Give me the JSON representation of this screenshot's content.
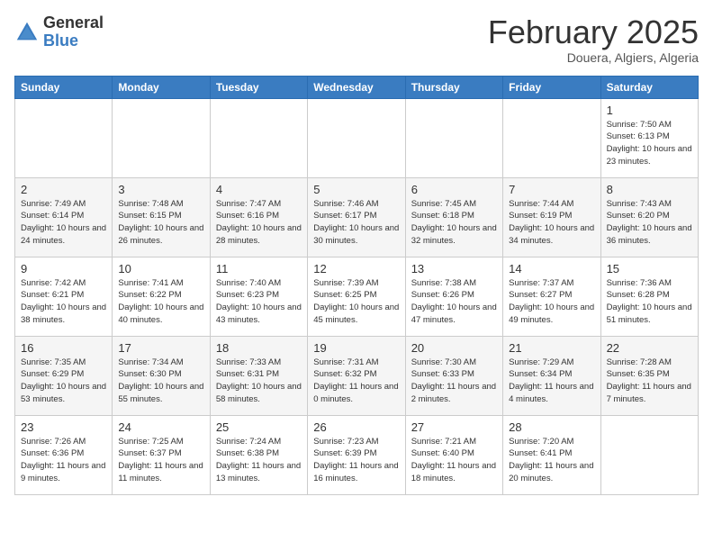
{
  "header": {
    "logo_general": "General",
    "logo_blue": "Blue",
    "month_title": "February 2025",
    "location": "Douera, Algiers, Algeria"
  },
  "days_of_week": [
    "Sunday",
    "Monday",
    "Tuesday",
    "Wednesday",
    "Thursday",
    "Friday",
    "Saturday"
  ],
  "weeks": [
    [
      {
        "day": "",
        "info": ""
      },
      {
        "day": "",
        "info": ""
      },
      {
        "day": "",
        "info": ""
      },
      {
        "day": "",
        "info": ""
      },
      {
        "day": "",
        "info": ""
      },
      {
        "day": "",
        "info": ""
      },
      {
        "day": "1",
        "info": "Sunrise: 7:50 AM\nSunset: 6:13 PM\nDaylight: 10 hours and 23 minutes."
      }
    ],
    [
      {
        "day": "2",
        "info": "Sunrise: 7:49 AM\nSunset: 6:14 PM\nDaylight: 10 hours and 24 minutes."
      },
      {
        "day": "3",
        "info": "Sunrise: 7:48 AM\nSunset: 6:15 PM\nDaylight: 10 hours and 26 minutes."
      },
      {
        "day": "4",
        "info": "Sunrise: 7:47 AM\nSunset: 6:16 PM\nDaylight: 10 hours and 28 minutes."
      },
      {
        "day": "5",
        "info": "Sunrise: 7:46 AM\nSunset: 6:17 PM\nDaylight: 10 hours and 30 minutes."
      },
      {
        "day": "6",
        "info": "Sunrise: 7:45 AM\nSunset: 6:18 PM\nDaylight: 10 hours and 32 minutes."
      },
      {
        "day": "7",
        "info": "Sunrise: 7:44 AM\nSunset: 6:19 PM\nDaylight: 10 hours and 34 minutes."
      },
      {
        "day": "8",
        "info": "Sunrise: 7:43 AM\nSunset: 6:20 PM\nDaylight: 10 hours and 36 minutes."
      }
    ],
    [
      {
        "day": "9",
        "info": "Sunrise: 7:42 AM\nSunset: 6:21 PM\nDaylight: 10 hours and 38 minutes."
      },
      {
        "day": "10",
        "info": "Sunrise: 7:41 AM\nSunset: 6:22 PM\nDaylight: 10 hours and 40 minutes."
      },
      {
        "day": "11",
        "info": "Sunrise: 7:40 AM\nSunset: 6:23 PM\nDaylight: 10 hours and 43 minutes."
      },
      {
        "day": "12",
        "info": "Sunrise: 7:39 AM\nSunset: 6:25 PM\nDaylight: 10 hours and 45 minutes."
      },
      {
        "day": "13",
        "info": "Sunrise: 7:38 AM\nSunset: 6:26 PM\nDaylight: 10 hours and 47 minutes."
      },
      {
        "day": "14",
        "info": "Sunrise: 7:37 AM\nSunset: 6:27 PM\nDaylight: 10 hours and 49 minutes."
      },
      {
        "day": "15",
        "info": "Sunrise: 7:36 AM\nSunset: 6:28 PM\nDaylight: 10 hours and 51 minutes."
      }
    ],
    [
      {
        "day": "16",
        "info": "Sunrise: 7:35 AM\nSunset: 6:29 PM\nDaylight: 10 hours and 53 minutes."
      },
      {
        "day": "17",
        "info": "Sunrise: 7:34 AM\nSunset: 6:30 PM\nDaylight: 10 hours and 55 minutes."
      },
      {
        "day": "18",
        "info": "Sunrise: 7:33 AM\nSunset: 6:31 PM\nDaylight: 10 hours and 58 minutes."
      },
      {
        "day": "19",
        "info": "Sunrise: 7:31 AM\nSunset: 6:32 PM\nDaylight: 11 hours and 0 minutes."
      },
      {
        "day": "20",
        "info": "Sunrise: 7:30 AM\nSunset: 6:33 PM\nDaylight: 11 hours and 2 minutes."
      },
      {
        "day": "21",
        "info": "Sunrise: 7:29 AM\nSunset: 6:34 PM\nDaylight: 11 hours and 4 minutes."
      },
      {
        "day": "22",
        "info": "Sunrise: 7:28 AM\nSunset: 6:35 PM\nDaylight: 11 hours and 7 minutes."
      }
    ],
    [
      {
        "day": "23",
        "info": "Sunrise: 7:26 AM\nSunset: 6:36 PM\nDaylight: 11 hours and 9 minutes."
      },
      {
        "day": "24",
        "info": "Sunrise: 7:25 AM\nSunset: 6:37 PM\nDaylight: 11 hours and 11 minutes."
      },
      {
        "day": "25",
        "info": "Sunrise: 7:24 AM\nSunset: 6:38 PM\nDaylight: 11 hours and 13 minutes."
      },
      {
        "day": "26",
        "info": "Sunrise: 7:23 AM\nSunset: 6:39 PM\nDaylight: 11 hours and 16 minutes."
      },
      {
        "day": "27",
        "info": "Sunrise: 7:21 AM\nSunset: 6:40 PM\nDaylight: 11 hours and 18 minutes."
      },
      {
        "day": "28",
        "info": "Sunrise: 7:20 AM\nSunset: 6:41 PM\nDaylight: 11 hours and 20 minutes."
      },
      {
        "day": "",
        "info": ""
      }
    ]
  ]
}
